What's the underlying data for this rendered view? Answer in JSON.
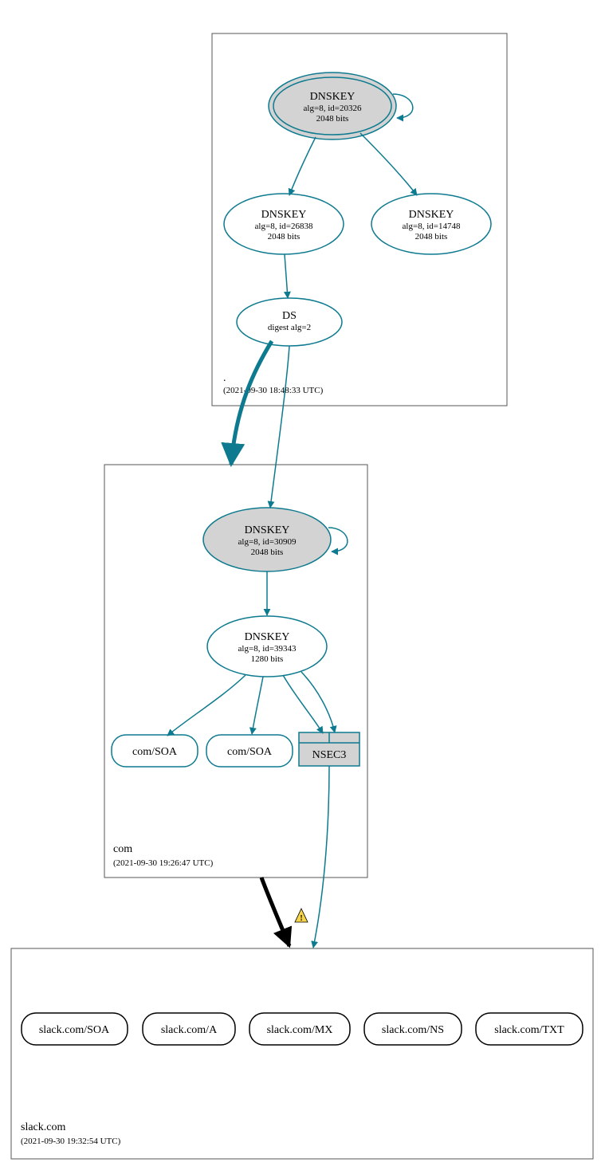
{
  "zones": {
    "root": {
      "label": ".",
      "timestamp": "(2021-09-30 18:48:33 UTC)"
    },
    "com": {
      "label": "com",
      "timestamp": "(2021-09-30 19:26:47 UTC)"
    },
    "slack": {
      "label": "slack.com",
      "timestamp": "(2021-09-30 19:32:54 UTC)"
    }
  },
  "nodes": {
    "rootKsk": {
      "t1": "DNSKEY",
      "t2": "alg=8, id=20326",
      "t3": "2048 bits"
    },
    "rootZsk1": {
      "t1": "DNSKEY",
      "t2": "alg=8, id=26838",
      "t3": "2048 bits"
    },
    "rootZsk2": {
      "t1": "DNSKEY",
      "t2": "alg=8, id=14748",
      "t3": "2048 bits"
    },
    "ds": {
      "t1": "DS",
      "t2": "digest alg=2"
    },
    "comKsk": {
      "t1": "DNSKEY",
      "t2": "alg=8, id=30909",
      "t3": "2048 bits"
    },
    "comZsk": {
      "t1": "DNSKEY",
      "t2": "alg=8, id=39343",
      "t3": "1280 bits"
    },
    "comSoa1": {
      "t1": "com/SOA"
    },
    "comSoa2": {
      "t1": "com/SOA"
    },
    "nsec3": {
      "t1": "NSEC3"
    },
    "slackSoa": {
      "t1": "slack.com/SOA"
    },
    "slackA": {
      "t1": "slack.com/A"
    },
    "slackMx": {
      "t1": "slack.com/MX"
    },
    "slackNs": {
      "t1": "slack.com/NS"
    },
    "slackTxt": {
      "t1": "slack.com/TXT"
    }
  },
  "warning_glyph": "⚠"
}
